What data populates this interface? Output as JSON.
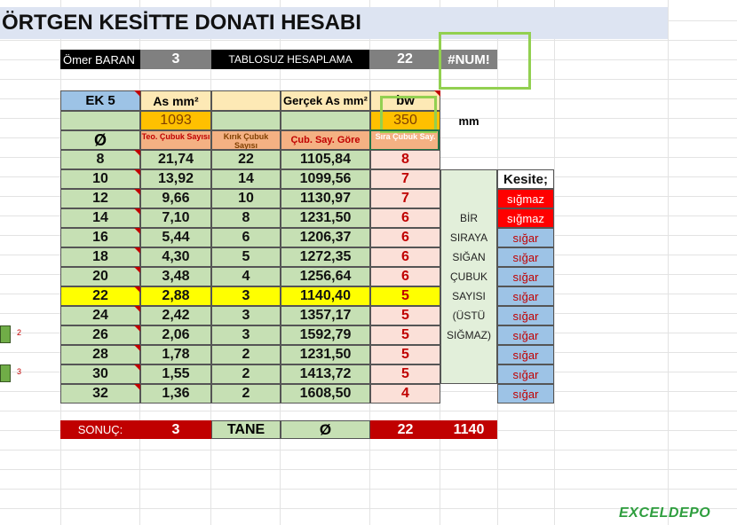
{
  "title": "ÖRTGEN KESİTTE DONATI HESABI",
  "info": {
    "author": "Ömer BARAN",
    "author_num": "3",
    "mode": "TABLOSUZ HESAPLAMA",
    "mode_num": "22",
    "error": "#NUM!"
  },
  "header": {
    "ek": "EK 5",
    "as_label": "As mm²",
    "gercek_label": "Gerçek  As mm²",
    "bw_label": "bw",
    "as_value": "1093",
    "bw_value": "350",
    "unit": "mm",
    "phi": "Ø",
    "teo_label": "Teo. Çubuk Sayısı",
    "kirik_label": "Kırık Çubuk Sayısı",
    "cub_say_label": "Çub. Say. Göre",
    "sira_label": "Sıra Çubuk Say."
  },
  "rows": [
    {
      "d": "8",
      "teo": "21,74",
      "kirik": "22",
      "gercek": "1105,84",
      "sira": "8",
      "kesite": ""
    },
    {
      "d": "10",
      "teo": "13,92",
      "kirik": "14",
      "gercek": "1099,56",
      "sira": "7",
      "kesite": "Kesite;"
    },
    {
      "d": "12",
      "teo": "9,66",
      "kirik": "10",
      "gercek": "1130,97",
      "sira": "7",
      "kesite": "sığmaz"
    },
    {
      "d": "14",
      "teo": "7,10",
      "kirik": "8",
      "gercek": "1231,50",
      "sira": "6",
      "kesite": "sığmaz"
    },
    {
      "d": "16",
      "teo": "5,44",
      "kirik": "6",
      "gercek": "1206,37",
      "sira": "6",
      "kesite": "sığar"
    },
    {
      "d": "18",
      "teo": "4,30",
      "kirik": "5",
      "gercek": "1272,35",
      "sira": "6",
      "kesite": "sığar"
    },
    {
      "d": "20",
      "teo": "3,48",
      "kirik": "4",
      "gercek": "1256,64",
      "sira": "6",
      "kesite": "sığar"
    },
    {
      "d": "22",
      "teo": "2,88",
      "kirik": "3",
      "gercek": "1140,40",
      "sira": "5",
      "kesite": "sığar"
    },
    {
      "d": "24",
      "teo": "2,42",
      "kirik": "3",
      "gercek": "1357,17",
      "sira": "5",
      "kesite": "sığar"
    },
    {
      "d": "26",
      "teo": "2,06",
      "kirik": "3",
      "gercek": "1592,79",
      "sira": "5",
      "kesite": "sığar"
    },
    {
      "d": "28",
      "teo": "1,78",
      "kirik": "2",
      "gercek": "1231,50",
      "sira": "5",
      "kesite": "sığar"
    },
    {
      "d": "30",
      "teo": "1,55",
      "kirik": "2",
      "gercek": "1413,72",
      "sira": "5",
      "kesite": "sığar"
    },
    {
      "d": "32",
      "teo": "1,36",
      "kirik": "2",
      "gercek": "1608,50",
      "sira": "4",
      "kesite": "sığar"
    }
  ],
  "side_note": [
    "BİR",
    "SIRAYA",
    "SIĞAN",
    "ÇUBUK",
    "SAYISI",
    "(ÜSTÜ",
    "SIĞMAZ)"
  ],
  "result": {
    "label": "SONUÇ:",
    "count": "3",
    "tane": "TANE",
    "phi": "Ø",
    "diameter": "22",
    "area": "1140"
  },
  "left_markers": [
    "2",
    "3"
  ],
  "watermark": "EXCELDEPO",
  "colors": {
    "green_cell": "#c6e0b4",
    "orange_cell": "#f4b183",
    "pink_cell": "#fbe0d8",
    "yellow_highlight": "#ffff00",
    "red_result": "#c00000",
    "blue_sigar": "#9dc3e6",
    "red_sigmaz": "#ff0000",
    "dark_cell": "#000000",
    "gray_cell": "#808080"
  }
}
